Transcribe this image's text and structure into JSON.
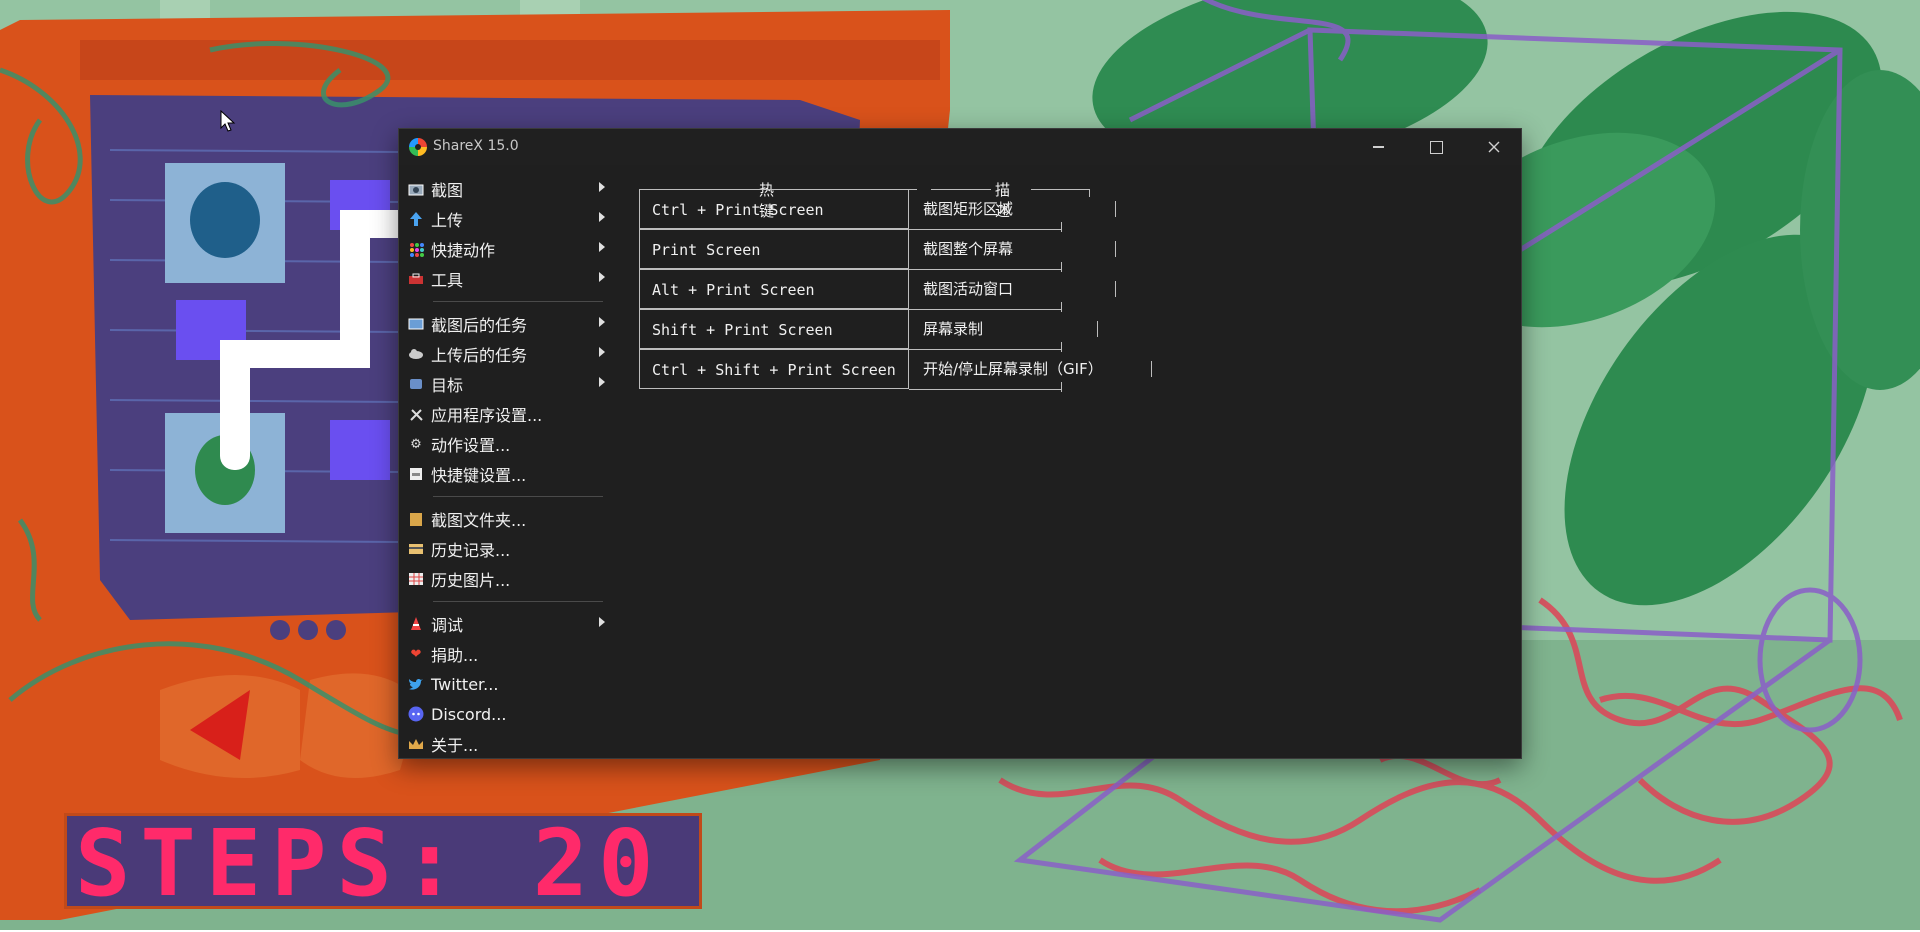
{
  "window": {
    "title": "ShareX 15.0"
  },
  "menu": {
    "items": [
      {
        "label": "截图",
        "icon": "camera-icon",
        "submenu": true
      },
      {
        "label": "上传",
        "icon": "up-arrow-icon",
        "submenu": true
      },
      {
        "label": "快捷动作",
        "icon": "grid-dots-icon",
        "submenu": true
      },
      {
        "label": "工具",
        "icon": "toolbox-icon",
        "submenu": true
      },
      {
        "label": "截图后的任务",
        "icon": "image-task-icon",
        "submenu": true
      },
      {
        "label": "上传后的任务",
        "icon": "cloud-upload-icon",
        "submenu": true
      },
      {
        "label": "目标",
        "icon": "target-icon",
        "submenu": true
      },
      {
        "label": "应用程序设置...",
        "icon": "wrench-icon",
        "submenu": false
      },
      {
        "label": "动作设置...",
        "icon": "gear-icon",
        "submenu": false
      },
      {
        "label": "快捷键设置...",
        "icon": "keyboard-icon",
        "submenu": false
      },
      {
        "label": "截图文件夹...",
        "icon": "folder-icon",
        "submenu": false
      },
      {
        "label": "历史记录...",
        "icon": "history-icon",
        "submenu": false
      },
      {
        "label": "历史图片...",
        "icon": "image-grid-icon",
        "submenu": false
      },
      {
        "label": "调试",
        "icon": "cone-icon",
        "submenu": true
      },
      {
        "label": "捐助...",
        "icon": "heart-icon",
        "submenu": false
      },
      {
        "label": "Twitter...",
        "icon": "twitter-icon",
        "submenu": false
      },
      {
        "label": "Discord...",
        "icon": "discord-icon",
        "submenu": false
      },
      {
        "label": "关于...",
        "icon": "crown-icon",
        "submenu": false
      }
    ]
  },
  "hotkeys": {
    "header_key": "热键",
    "header_desc": "描述",
    "rows": [
      {
        "key": "Ctrl + Print Screen",
        "desc": "截图矩形区域"
      },
      {
        "key": "Print Screen",
        "desc": "截图整个屏幕"
      },
      {
        "key": "Alt + Print Screen",
        "desc": "截图活动窗口"
      },
      {
        "key": "Shift + Print Screen",
        "desc": "屏幕录制"
      },
      {
        "key": "Ctrl + Shift + Print Screen",
        "desc": "开始/停止屏幕录制（GIF）"
      }
    ]
  },
  "game": {
    "steps_text": "STEPS: 20"
  },
  "colors": {
    "window_bg": "#1f1f1f",
    "game_bg": "#8fbf9c",
    "machine_orange": "#d9521b",
    "steps_red": "#ff2a6a"
  }
}
